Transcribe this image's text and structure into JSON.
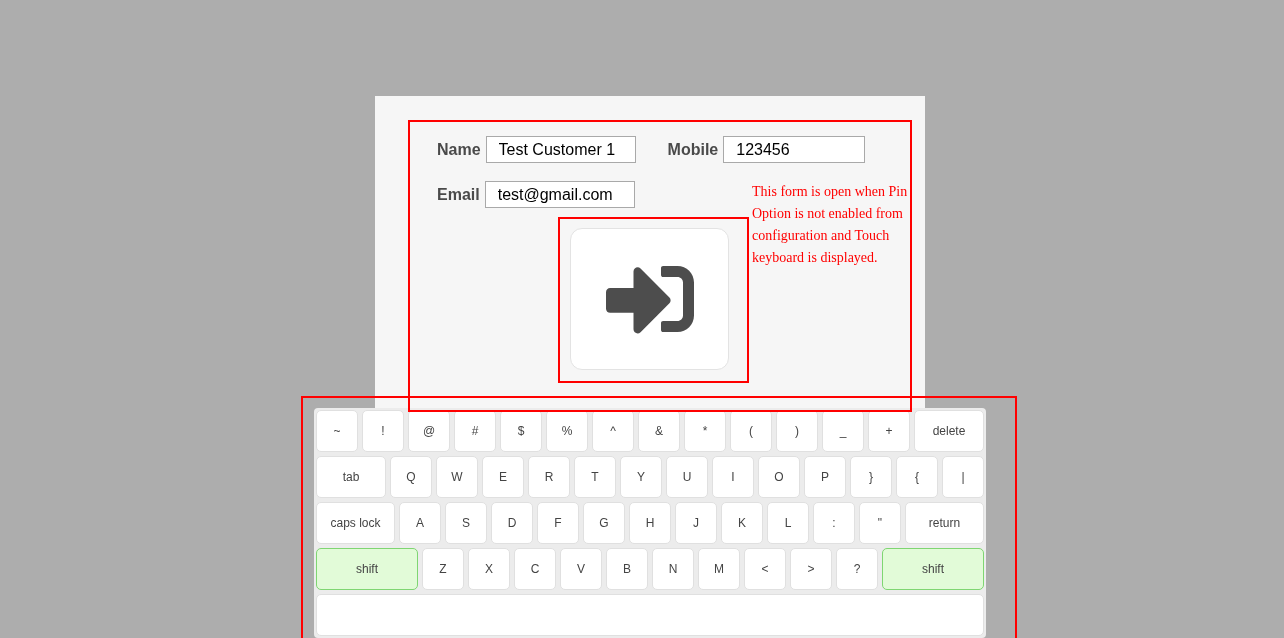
{
  "form": {
    "fields": [
      {
        "label": "Name",
        "value": "Test Customer 1"
      },
      {
        "label": "Mobile",
        "value": "123456"
      },
      {
        "label": "Email",
        "value": "test@gmail.com"
      }
    ],
    "note": "This form is open when Pin Option is not enabled from configuration and Touch keyboard is displayed."
  },
  "keyboard": {
    "rows": [
      [
        {
          "label": "~",
          "kind": "char"
        },
        {
          "label": "!",
          "kind": "char"
        },
        {
          "label": "@",
          "kind": "char"
        },
        {
          "label": "#",
          "kind": "char"
        },
        {
          "label": "$",
          "kind": "char"
        },
        {
          "label": "%",
          "kind": "char"
        },
        {
          "label": "^",
          "kind": "char"
        },
        {
          "label": "&",
          "kind": "char"
        },
        {
          "label": "*",
          "kind": "char"
        },
        {
          "label": "(",
          "kind": "char"
        },
        {
          "label": ")",
          "kind": "char"
        },
        {
          "label": "_",
          "kind": "char"
        },
        {
          "label": "+",
          "kind": "char"
        },
        {
          "label": "delete",
          "kind": "wide"
        }
      ],
      [
        {
          "label": "tab",
          "kind": "wide"
        },
        {
          "label": "Q",
          "kind": "char"
        },
        {
          "label": "W",
          "kind": "char"
        },
        {
          "label": "E",
          "kind": "char"
        },
        {
          "label": "R",
          "kind": "char"
        },
        {
          "label": "T",
          "kind": "char"
        },
        {
          "label": "Y",
          "kind": "char"
        },
        {
          "label": "U",
          "kind": "char"
        },
        {
          "label": "I",
          "kind": "char"
        },
        {
          "label": "O",
          "kind": "char"
        },
        {
          "label": "P",
          "kind": "char"
        },
        {
          "label": "}",
          "kind": "char"
        },
        {
          "label": "{",
          "kind": "char"
        },
        {
          "label": "|",
          "kind": "char"
        }
      ],
      [
        {
          "label": "caps lock",
          "kind": "wide"
        },
        {
          "label": "A",
          "kind": "char"
        },
        {
          "label": "S",
          "kind": "char"
        },
        {
          "label": "D",
          "kind": "char"
        },
        {
          "label": "F",
          "kind": "char"
        },
        {
          "label": "G",
          "kind": "char"
        },
        {
          "label": "H",
          "kind": "char"
        },
        {
          "label": "J",
          "kind": "char"
        },
        {
          "label": "K",
          "kind": "char"
        },
        {
          "label": "L",
          "kind": "char"
        },
        {
          "label": ":",
          "kind": "char"
        },
        {
          "label": "\"",
          "kind": "char"
        },
        {
          "label": "return",
          "kind": "wide"
        }
      ],
      [
        {
          "label": "shift",
          "kind": "wide",
          "active": true
        },
        {
          "label": "Z",
          "kind": "char"
        },
        {
          "label": "X",
          "kind": "char"
        },
        {
          "label": "C",
          "kind": "char"
        },
        {
          "label": "V",
          "kind": "char"
        },
        {
          "label": "B",
          "kind": "char"
        },
        {
          "label": "N",
          "kind": "char"
        },
        {
          "label": "M",
          "kind": "char"
        },
        {
          "label": "<",
          "kind": "char"
        },
        {
          "label": ">",
          "kind": "char"
        },
        {
          "label": "?",
          "kind": "char"
        },
        {
          "label": "shift",
          "kind": "wide",
          "active": true
        }
      ],
      [
        {
          "kind": "space"
        }
      ]
    ]
  }
}
